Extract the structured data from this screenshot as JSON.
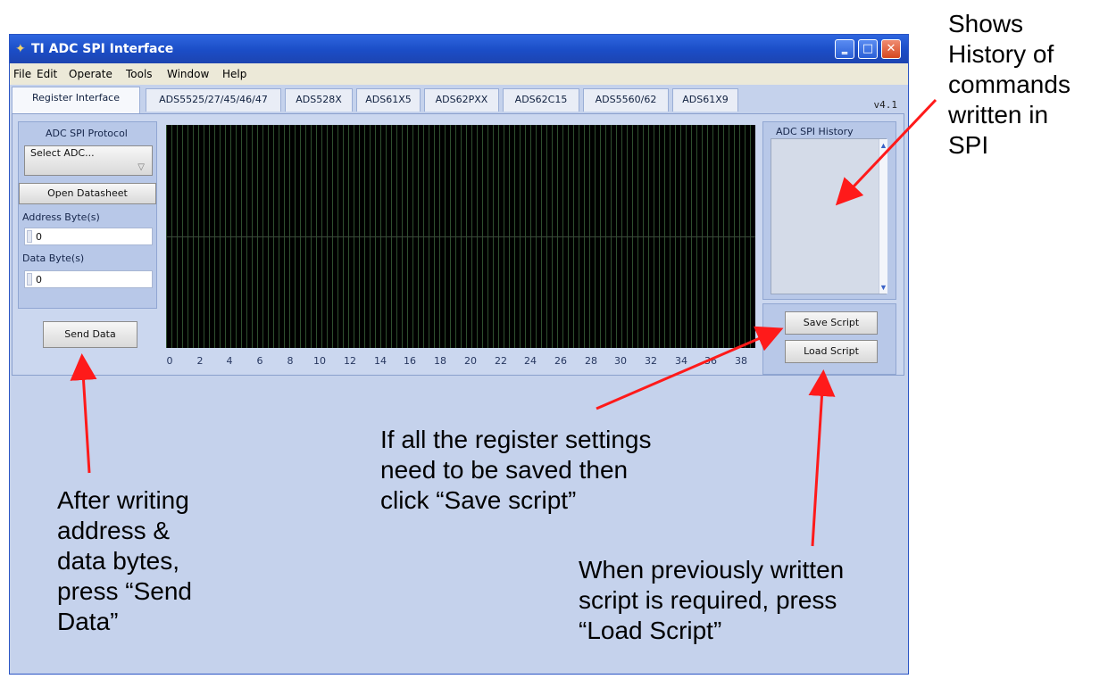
{
  "window": {
    "title": "TI ADC SPI Interface",
    "menu": [
      "File",
      "Edit",
      "Operate",
      "Tools",
      "Window",
      "Help"
    ],
    "controls": {
      "minimize": "‗",
      "maximize": "□",
      "close": "✕"
    }
  },
  "tabs": [
    "Register Interface",
    "ADS5525/27/45/46/47",
    "ADS528X",
    "ADS61X5",
    "ADS62PXX",
    "ADS62C15",
    "ADS5560/62",
    "ADS61X9"
  ],
  "version": "v4.1",
  "protocol": {
    "heading": "ADC SPI Protocol",
    "select_placeholder": "Select ADC...",
    "open_datasheet": "Open Datasheet",
    "address_label": "Address Byte(s)",
    "address_value": "0",
    "data_label": "Data Byte(s)",
    "data_value": "0",
    "send_button": "Send Data"
  },
  "plot": {
    "x_ticks": [
      "0",
      "2",
      "4",
      "6",
      "8",
      "10",
      "12",
      "14",
      "16",
      "18",
      "20",
      "22",
      "24",
      "26",
      "28",
      "30",
      "32",
      "34",
      "36",
      "38"
    ]
  },
  "history": {
    "heading": "ADC SPI History"
  },
  "scripts": {
    "save": "Save Script",
    "load": "Load Script"
  },
  "annotations": {
    "history_note": [
      "Shows",
      "History of",
      "commands",
      "written in",
      "SPI"
    ],
    "send_note": [
      "After writing",
      "address &",
      "data bytes,",
      "press “Send",
      "Data”"
    ],
    "save_note": [
      "If all the register settings",
      "need to be saved then",
      "click “Save script”"
    ],
    "load_note": [
      "When previously written",
      "script is required, press",
      "“Load Script”"
    ]
  },
  "colors": {
    "arrow": "#ff1a1a",
    "titlebar": "#1b4dc6",
    "window_bg": "#c5d2ec"
  }
}
